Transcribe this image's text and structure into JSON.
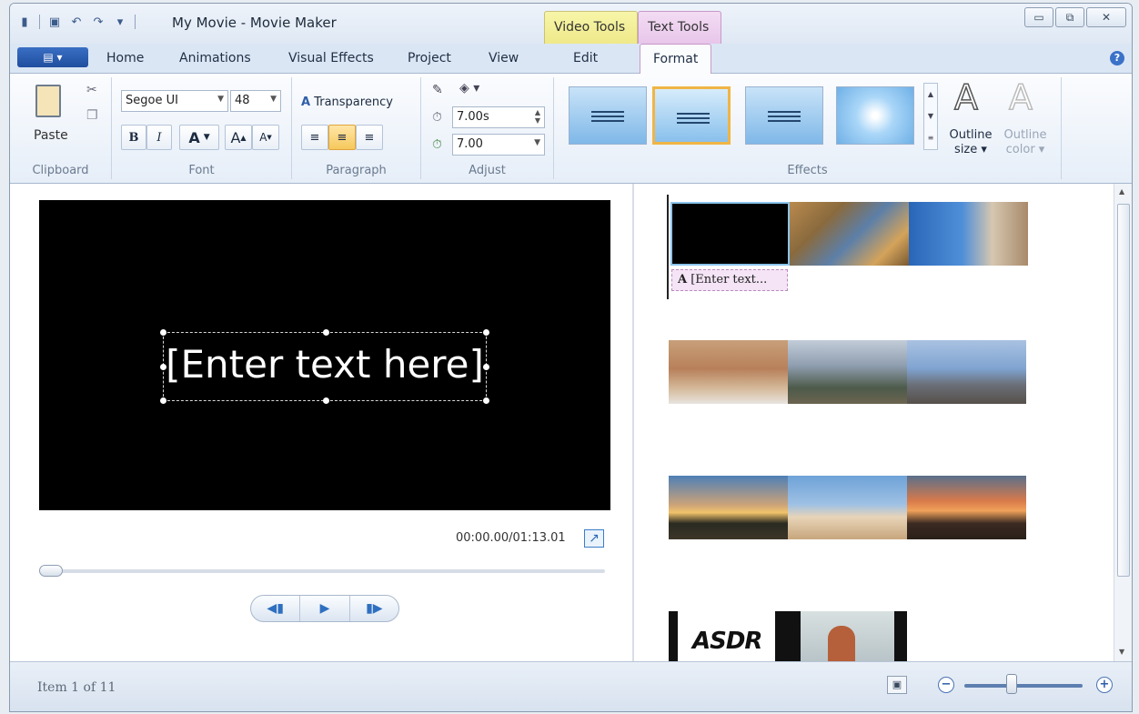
{
  "window": {
    "title": "My Movie - Movie Maker",
    "minimize_icon": "minimize-icon",
    "maximize_icon": "restore-icon",
    "close_icon": "close-icon"
  },
  "context_tabs": {
    "video_tools": "Video Tools",
    "text_tools": "Text Tools"
  },
  "ribbon_tabs": [
    {
      "label": "Home"
    },
    {
      "label": "Animations"
    },
    {
      "label": "Visual Effects"
    },
    {
      "label": "Project"
    },
    {
      "label": "View"
    },
    {
      "label": "Edit"
    },
    {
      "label": "Format"
    }
  ],
  "ribbon": {
    "clipboard": {
      "label": "Clipboard",
      "paste": "Paste"
    },
    "font": {
      "label": "Font",
      "family": "Segoe UI",
      "size": "48",
      "bold": "B",
      "italic": "I",
      "color": "A",
      "grow": "A",
      "shrink": "A"
    },
    "paragraph": {
      "label": "Paragraph",
      "transparency": "Transparency"
    },
    "adjust": {
      "label": "Adjust",
      "start_time": "7.00s",
      "duration": "7.00"
    },
    "effects": {
      "label": "Effects",
      "outline_size": "Outline",
      "outline_size_2": "size",
      "outline_color": "Outline",
      "outline_color_2": "color"
    }
  },
  "preview": {
    "text": "[Enter text here]",
    "timecode": "00:00.00/01:13.01"
  },
  "storyboard": {
    "caption": "[Enter text..."
  },
  "status": {
    "item": "Item 1 of 11"
  },
  "colors": {
    "video_tools": "#f1ec93",
    "text_tools": "#eccbed",
    "accent": "#2a68b6",
    "selected_effect": "#f0b545"
  },
  "zoom": {
    "level": 0.4
  }
}
